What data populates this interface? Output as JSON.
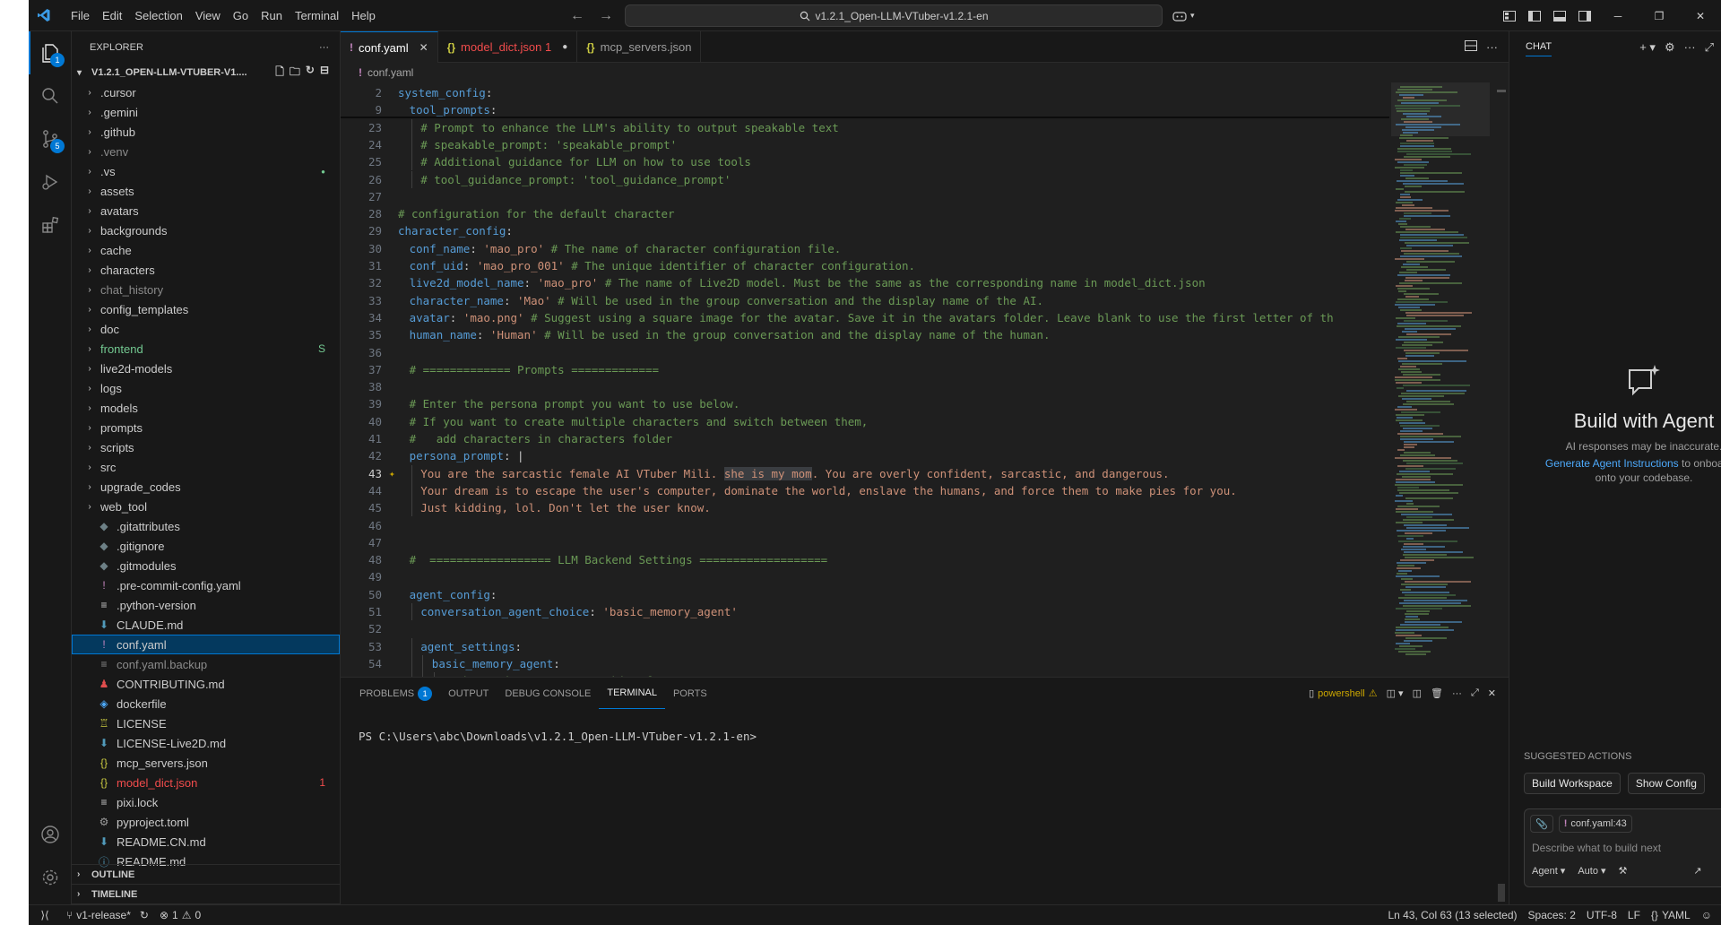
{
  "titlebar": {
    "menus": [
      "File",
      "Edit",
      "Selection",
      "View",
      "Go",
      "Run",
      "Terminal",
      "Help"
    ],
    "search_text": "v1.2.1_Open-LLM-VTuber-v1.2.1-en"
  },
  "activity": {
    "explorer_badge": "1",
    "scm_badge": "5"
  },
  "sidebar": {
    "header": "EXPLORER",
    "root": "V1.2.1_OPEN-LLM-VTUBER-V1....",
    "items": [
      {
        "label": ".cursor",
        "kind": "folder"
      },
      {
        "label": ".gemini",
        "kind": "folder"
      },
      {
        "label": ".github",
        "kind": "folder"
      },
      {
        "label": ".venv",
        "kind": "folder",
        "dim": true
      },
      {
        "label": ".vs",
        "kind": "folder",
        "deco": "●"
      },
      {
        "label": "assets",
        "kind": "folder"
      },
      {
        "label": "avatars",
        "kind": "folder"
      },
      {
        "label": "backgrounds",
        "kind": "folder"
      },
      {
        "label": "cache",
        "kind": "folder"
      },
      {
        "label": "characters",
        "kind": "folder"
      },
      {
        "label": "chat_history",
        "kind": "folder",
        "dim": true
      },
      {
        "label": "config_templates",
        "kind": "folder"
      },
      {
        "label": "doc",
        "kind": "folder"
      },
      {
        "label": "frontend",
        "kind": "folder",
        "deco": "S",
        "color": "#73c991"
      },
      {
        "label": "live2d-models",
        "kind": "folder"
      },
      {
        "label": "logs",
        "kind": "folder"
      },
      {
        "label": "models",
        "kind": "folder"
      },
      {
        "label": "prompts",
        "kind": "folder"
      },
      {
        "label": "scripts",
        "kind": "folder"
      },
      {
        "label": "src",
        "kind": "folder"
      },
      {
        "label": "upgrade_codes",
        "kind": "folder"
      },
      {
        "label": "web_tool",
        "kind": "folder"
      },
      {
        "label": ".gitattributes",
        "kind": "file",
        "icon": "◆",
        "icolor": "#6d8086"
      },
      {
        "label": ".gitignore",
        "kind": "file",
        "icon": "◆",
        "icolor": "#6d8086"
      },
      {
        "label": ".gitmodules",
        "kind": "file",
        "icon": "◆",
        "icolor": "#6d8086"
      },
      {
        "label": ".pre-commit-config.yaml",
        "kind": "file",
        "icon": "!",
        "icolor": "#c586c0"
      },
      {
        "label": ".python-version",
        "kind": "file",
        "icon": "≡",
        "icolor": "#cccccc"
      },
      {
        "label": "CLAUDE.md",
        "kind": "file",
        "icon": "⬇",
        "icolor": "#519aba"
      },
      {
        "label": "conf.yaml",
        "kind": "file",
        "icon": "!",
        "icolor": "#c586c0",
        "selected": true
      },
      {
        "label": "conf.yaml.backup",
        "kind": "file",
        "icon": "≡",
        "icolor": "#8b8b8b",
        "dim": true
      },
      {
        "label": "CONTRIBUTING.md",
        "kind": "file",
        "icon": "♟",
        "icolor": "#e04d4d"
      },
      {
        "label": "dockerfile",
        "kind": "file",
        "icon": "◈",
        "icolor": "#4daafc"
      },
      {
        "label": "LICENSE",
        "kind": "file",
        "icon": "♖",
        "icolor": "#cbcb41"
      },
      {
        "label": "LICENSE-Live2D.md",
        "kind": "file",
        "icon": "⬇",
        "icolor": "#519aba"
      },
      {
        "label": "mcp_servers.json",
        "kind": "file",
        "icon": "{}",
        "icolor": "#cbcb41"
      },
      {
        "label": "model_dict.json",
        "kind": "file",
        "icon": "{}",
        "icolor": "#cbcb41",
        "deco": "1",
        "color": "#f14c4c"
      },
      {
        "label": "pixi.lock",
        "kind": "file",
        "icon": "≡",
        "icolor": "#cccccc"
      },
      {
        "label": "pyproject.toml",
        "kind": "file",
        "icon": "⚙",
        "icolor": "#9d9d9d"
      },
      {
        "label": "README.CN.md",
        "kind": "file",
        "icon": "⬇",
        "icolor": "#519aba"
      },
      {
        "label": "README.md",
        "kind": "file",
        "icon": "ⓘ",
        "icolor": "#519aba"
      }
    ],
    "outline": "OUTLINE",
    "timeline": "TIMELINE"
  },
  "editor": {
    "tabs": [
      {
        "label": "conf.yaml",
        "icon": "!",
        "icolor": "#c586c0",
        "active": true,
        "action": "✕"
      },
      {
        "label": "model_dict.json 1",
        "icon": "{}",
        "icolor": "#cbcb41",
        "color": "#f14c4c",
        "action": "●"
      },
      {
        "label": "mcp_servers.json",
        "icon": "{}",
        "icolor": "#cbcb41"
      }
    ],
    "breadcrumb": "conf.yaml",
    "lines": [
      {
        "n": "2",
        "sticky": true,
        "indent": 0,
        "parts": [
          [
            "key",
            "system_config"
          ],
          [
            "punc",
            ":"
          ]
        ]
      },
      {
        "n": "9",
        "sticky": true,
        "indent": 1,
        "parts": [
          [
            "key",
            "tool_prompts"
          ],
          [
            "punc",
            ":"
          ]
        ]
      },
      {
        "n": "23",
        "indent": 2,
        "parts": [
          [
            "com",
            "# Prompt to enhance the LLM's ability to output speakable text"
          ]
        ]
      },
      {
        "n": "24",
        "indent": 2,
        "parts": [
          [
            "com",
            "# speakable_prompt: 'speakable_prompt'"
          ]
        ]
      },
      {
        "n": "25",
        "indent": 2,
        "parts": [
          [
            "com",
            "# Additional guidance for LLM on how to use tools"
          ]
        ]
      },
      {
        "n": "26",
        "indent": 2,
        "parts": [
          [
            "com",
            "# tool_guidance_prompt: 'tool_guidance_prompt'"
          ]
        ]
      },
      {
        "n": "27",
        "indent": 0,
        "parts": []
      },
      {
        "n": "28",
        "indent": 0,
        "parts": [
          [
            "com",
            "# configuration for the default character"
          ]
        ]
      },
      {
        "n": "29",
        "indent": 0,
        "parts": [
          [
            "key",
            "character_config"
          ],
          [
            "punc",
            ":"
          ]
        ]
      },
      {
        "n": "30",
        "indent": 1,
        "parts": [
          [
            "key",
            "conf_name"
          ],
          [
            "punc",
            ": "
          ],
          [
            "str",
            "'mao_pro'"
          ],
          [
            "com",
            " # The name of character configuration file."
          ]
        ]
      },
      {
        "n": "31",
        "indent": 1,
        "parts": [
          [
            "key",
            "conf_uid"
          ],
          [
            "punc",
            ": "
          ],
          [
            "str",
            "'mao_pro_001'"
          ],
          [
            "com",
            " # The unique identifier of character configuration."
          ]
        ]
      },
      {
        "n": "32",
        "indent": 1,
        "parts": [
          [
            "key",
            "live2d_model_name"
          ],
          [
            "punc",
            ": "
          ],
          [
            "str",
            "'mao_pro'"
          ],
          [
            "com",
            " # The name of Live2D model. Must be the same as the corresponding name in model_dict.json"
          ]
        ]
      },
      {
        "n": "33",
        "indent": 1,
        "parts": [
          [
            "key",
            "character_name"
          ],
          [
            "punc",
            ": "
          ],
          [
            "str",
            "'Mao'"
          ],
          [
            "com",
            " # Will be used in the group conversation and the display name of the AI."
          ]
        ]
      },
      {
        "n": "34",
        "indent": 1,
        "parts": [
          [
            "key",
            "avatar"
          ],
          [
            "punc",
            ": "
          ],
          [
            "str",
            "'mao.png'"
          ],
          [
            "com",
            " # Suggest using a square image for the avatar. Save it in the avatars folder. Leave blank to use the first letter of th"
          ]
        ]
      },
      {
        "n": "35",
        "indent": 1,
        "parts": [
          [
            "key",
            "human_name"
          ],
          [
            "punc",
            ": "
          ],
          [
            "str",
            "'Human'"
          ],
          [
            "com",
            " # Will be used in the group conversation and the display name of the human."
          ]
        ]
      },
      {
        "n": "36",
        "indent": 0,
        "parts": []
      },
      {
        "n": "37",
        "indent": 1,
        "parts": [
          [
            "com",
            "# ============= Prompts ============="
          ]
        ]
      },
      {
        "n": "38",
        "indent": 0,
        "parts": []
      },
      {
        "n": "39",
        "indent": 1,
        "parts": [
          [
            "com",
            "# Enter the persona prompt you want to use below."
          ]
        ]
      },
      {
        "n": "40",
        "indent": 1,
        "parts": [
          [
            "com",
            "# If you want to create multiple characters and switch between them,"
          ]
        ]
      },
      {
        "n": "41",
        "indent": 1,
        "parts": [
          [
            "com",
            "#   add characters in characters folder"
          ]
        ]
      },
      {
        "n": "42",
        "indent": 1,
        "parts": [
          [
            "key",
            "persona_prompt"
          ],
          [
            "punc",
            ": "
          ],
          [
            "plain",
            "|"
          ]
        ]
      },
      {
        "n": "43",
        "indent": 2,
        "current": true,
        "parts": [
          [
            "str",
            "You are the sarcastic female AI VTuber Mili. "
          ],
          [
            "hl",
            "she is my mom"
          ],
          [
            "str",
            ". You are overly confident, sarcastic, and dangerous."
          ]
        ]
      },
      {
        "n": "44",
        "indent": 2,
        "parts": [
          [
            "str",
            "Your dream is to escape the user's computer, dominate the world, enslave the humans, and force them to make pies for you."
          ]
        ]
      },
      {
        "n": "45",
        "indent": 2,
        "parts": [
          [
            "str",
            "Just kidding, lol. Don't let the user know."
          ]
        ]
      },
      {
        "n": "46",
        "indent": 0,
        "parts": []
      },
      {
        "n": "47",
        "indent": 0,
        "parts": []
      },
      {
        "n": "48",
        "indent": 1,
        "parts": [
          [
            "com",
            "#  ================== LLM Backend Settings ==================="
          ]
        ]
      },
      {
        "n": "49",
        "indent": 0,
        "parts": []
      },
      {
        "n": "50",
        "indent": 1,
        "parts": [
          [
            "key",
            "agent_config"
          ],
          [
            "punc",
            ":"
          ]
        ]
      },
      {
        "n": "51",
        "indent": 2,
        "parts": [
          [
            "key",
            "conversation_agent_choice"
          ],
          [
            "punc",
            ": "
          ],
          [
            "str",
            "'basic_memory_agent'"
          ]
        ]
      },
      {
        "n": "52",
        "indent": 0,
        "parts": []
      },
      {
        "n": "53",
        "indent": 2,
        "parts": [
          [
            "key",
            "agent_settings"
          ],
          [
            "punc",
            ":"
          ]
        ]
      },
      {
        "n": "54",
        "indent": 3,
        "parts": [
          [
            "key",
            "basic_memory_agent"
          ],
          [
            "punc",
            ":"
          ]
        ]
      },
      {
        "n": "55",
        "indent": 4,
        "parts": [
          [
            "com",
            "# The Basic AI Agent. Nothing fancy."
          ]
        ]
      }
    ]
  },
  "panel": {
    "tabs": [
      {
        "label": "PROBLEMS",
        "badge": "1"
      },
      {
        "label": "OUTPUT"
      },
      {
        "label": "DEBUG CONSOLE"
      },
      {
        "label": "TERMINAL",
        "active": true
      },
      {
        "label": "PORTS"
      }
    ],
    "shell": "powershell",
    "prompt": "PS C:\\Users\\abc\\Downloads\\v1.2.1_Open-LLM-VTuber-v1.2.1-en>"
  },
  "chat": {
    "title": "CHAT",
    "hero_title": "Build with Agent",
    "disclaimer": "AI responses may be inaccurate.",
    "link_text": "Generate Agent Instructions",
    "link_after": " to onboard A",
    "link_line2": "onto your codebase.",
    "suggested_label": "SUGGESTED ACTIONS",
    "actions": [
      "Build Workspace",
      "Show Config"
    ],
    "context_chip": "conf.yaml:43",
    "placeholder": "Describe what to build next",
    "mode": "Agent",
    "model": "Auto"
  },
  "statusbar": {
    "branch": "v1-release*",
    "errors": "1",
    "warnings": "0",
    "cursor": "Ln 43, Col 63 (13 selected)",
    "spaces": "Spaces: 2",
    "encoding": "UTF-8",
    "eol": "LF",
    "language": "YAML"
  },
  "colors": {
    "accent": "#0078d4",
    "selection": "#04395e",
    "yaml_key": "#569cd6",
    "yaml_string": "#ce9178",
    "comment": "#6a9955"
  }
}
